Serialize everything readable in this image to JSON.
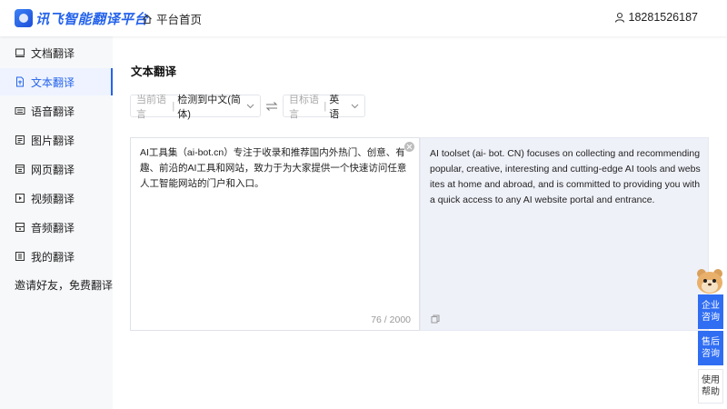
{
  "header": {
    "logo_text": "讯飞智能翻译平台",
    "home_label": "平台首页",
    "user_phone": "18281526187"
  },
  "sidebar": {
    "items": [
      {
        "label": "文档翻译",
        "icon": "document-icon",
        "active": false
      },
      {
        "label": "文本翻译",
        "icon": "text-file-icon",
        "active": true
      },
      {
        "label": "语音翻译",
        "icon": "keyboard-icon",
        "active": false
      },
      {
        "label": "图片翻译",
        "icon": "image-icon",
        "active": false
      },
      {
        "label": "网页翻译",
        "icon": "webpage-icon",
        "active": false
      },
      {
        "label": "视频翻译",
        "icon": "video-icon",
        "active": false
      },
      {
        "label": "音频翻译",
        "icon": "audio-icon",
        "active": false
      },
      {
        "label": "我的翻译",
        "icon": "my-translation-icon",
        "active": false
      }
    ],
    "invite_label": "邀请好友，免费翻译"
  },
  "main": {
    "title": "文本翻译",
    "source_lang": {
      "hint": "当前语言",
      "value": "检测到中文(简体)"
    },
    "target_lang": {
      "hint": "目标语言",
      "value": "英语"
    },
    "source_text": "AI工具集（ai-bot.cn）专注于收录和推荐国内外热门、创意、有趣、前沿的AI工具和网站，致力于为大家提供一个快速访问任意人工智能网站的门户和入口。",
    "char_count": "76 / 2000",
    "target_text": "AI toolset (ai- bot. CN) focuses on collecting and recommending popular, creative, interesting and cutting-edge AI tools and websites at home and abroad, and is committed to providing you with a quick access to any AI website portal and entrance."
  },
  "float": {
    "enterprise": [
      "企业",
      "咨询"
    ],
    "aftersale": [
      "售后",
      "咨询"
    ],
    "help": [
      "使用",
      "帮助"
    ]
  },
  "colors": {
    "accent": "#2563eb",
    "target_bg": "#eff1f9",
    "sidebar_bg": "#f7f8fa"
  }
}
